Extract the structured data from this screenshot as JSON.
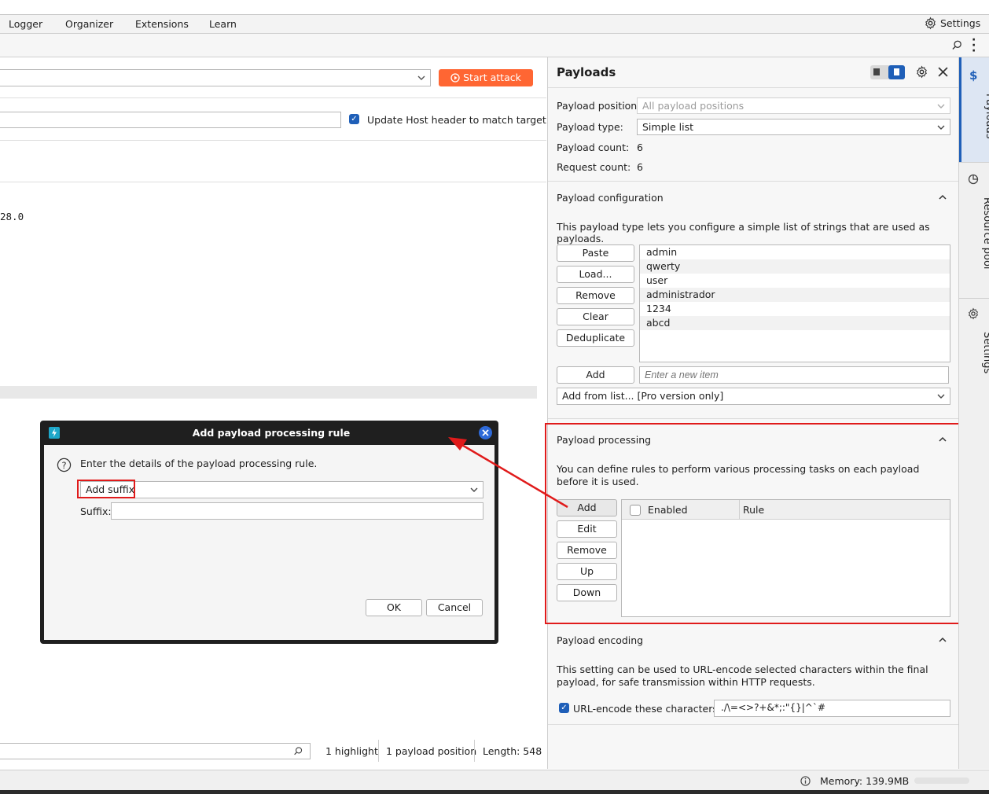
{
  "menubar": {
    "items": [
      "Logger",
      "Organizer",
      "Extensions",
      "Learn"
    ],
    "settings_label": "Settings"
  },
  "attack": {
    "start_label": "Start attack",
    "update_host_label": "Update Host header to match target",
    "request_fragment": "28.0"
  },
  "editor_status": {
    "highlight": "1 highlight",
    "positions": "1 payload position",
    "length": "Length: 548"
  },
  "payloads_panel": {
    "title": "Payloads",
    "position_label": "Payload position:",
    "position_value": "All payload positions",
    "type_label": "Payload type:",
    "type_value": "Simple list",
    "count_label": "Payload count:",
    "count_value": "6",
    "request_label": "Request count:",
    "request_value": "6"
  },
  "payload_config": {
    "title": "Payload configuration",
    "description": "This payload type lets you configure a simple list of strings that are used as payloads.",
    "buttons": [
      "Paste",
      "Load...",
      "Remove",
      "Clear",
      "Deduplicate"
    ],
    "items": [
      "admin",
      "qwerty",
      "user",
      "administrador",
      "1234",
      "abcd"
    ],
    "add_label": "Add",
    "new_item_placeholder": "Enter a new item",
    "add_from_list": "Add from list... [Pro version only]"
  },
  "payload_processing": {
    "title": "Payload processing",
    "description": "You can define rules to perform various processing tasks on each payload before it is used.",
    "buttons": [
      "Add",
      "Edit",
      "Remove",
      "Up",
      "Down"
    ],
    "columns": [
      "Enabled",
      "Rule"
    ]
  },
  "payload_encoding": {
    "title": "Payload encoding",
    "description": "This setting can be used to URL-encode selected characters within the final payload, for safe transmission within HTTP requests.",
    "checkbox_label": "URL-encode these characters:",
    "chars_value": "./\\=<>?+&*;:\"{}|^`#"
  },
  "side_tabs": [
    "Payloads",
    "Resource pool",
    "Settings"
  ],
  "status": {
    "memory": "Memory: 139.9MB"
  },
  "dialog": {
    "title": "Add payload processing rule",
    "prompt": "Enter the details of the payload processing rule.",
    "rule_type": "Add suffix",
    "suffix_label": "Suffix:",
    "ok_label": "OK",
    "cancel_label": "Cancel"
  },
  "colors": {
    "accent": "#ff6633",
    "primary_blue": "#1f5fb8",
    "annotation_red": "#e01b1b",
    "dialog_titlebar": "#1f1f1f"
  }
}
